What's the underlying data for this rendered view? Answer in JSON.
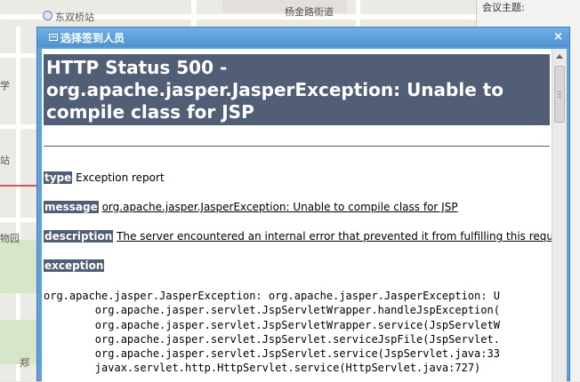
{
  "map": {
    "labels": [
      "东双桥站",
      "杨金路街道",
      "学",
      "站",
      "物园",
      "郑"
    ],
    "side_label": "会议主题:"
  },
  "dialog": {
    "title": "选择签到人员",
    "close_label": "×"
  },
  "error": {
    "heading": "HTTP Status 500 - org.apache.jasper.JasperException: Unable to compile class for JSP",
    "type_label": "type",
    "type_value": "Exception report",
    "message_label": "message",
    "message_value": "org.apache.jasper.JasperException: Unable to compile class for JSP",
    "description_label": "description",
    "description_value": "The server encountered an internal error that prevented it from fulfilling this request.",
    "exception_label": "exception",
    "stacktrace": [
      "org.apache.jasper.JasperException: org.apache.jasper.JasperException: U",
      "\torg.apache.jasper.servlet.JspServletWrapper.handleJspException(",
      "\torg.apache.jasper.servlet.JspServletWrapper.service(JspServletW",
      "\torg.apache.jasper.servlet.JspServlet.serviceJspFile(JspServlet.",
      "\torg.apache.jasper.servlet.JspServlet.service(JspServlet.java:33",
      "\tjavax.servlet.http.HttpServlet.service(HttpServlet.java:727)"
    ]
  },
  "icons": {
    "title_icon": "window-icon",
    "close_icon": "close-icon",
    "scroll_up_icon": "chevron-up-icon"
  }
}
